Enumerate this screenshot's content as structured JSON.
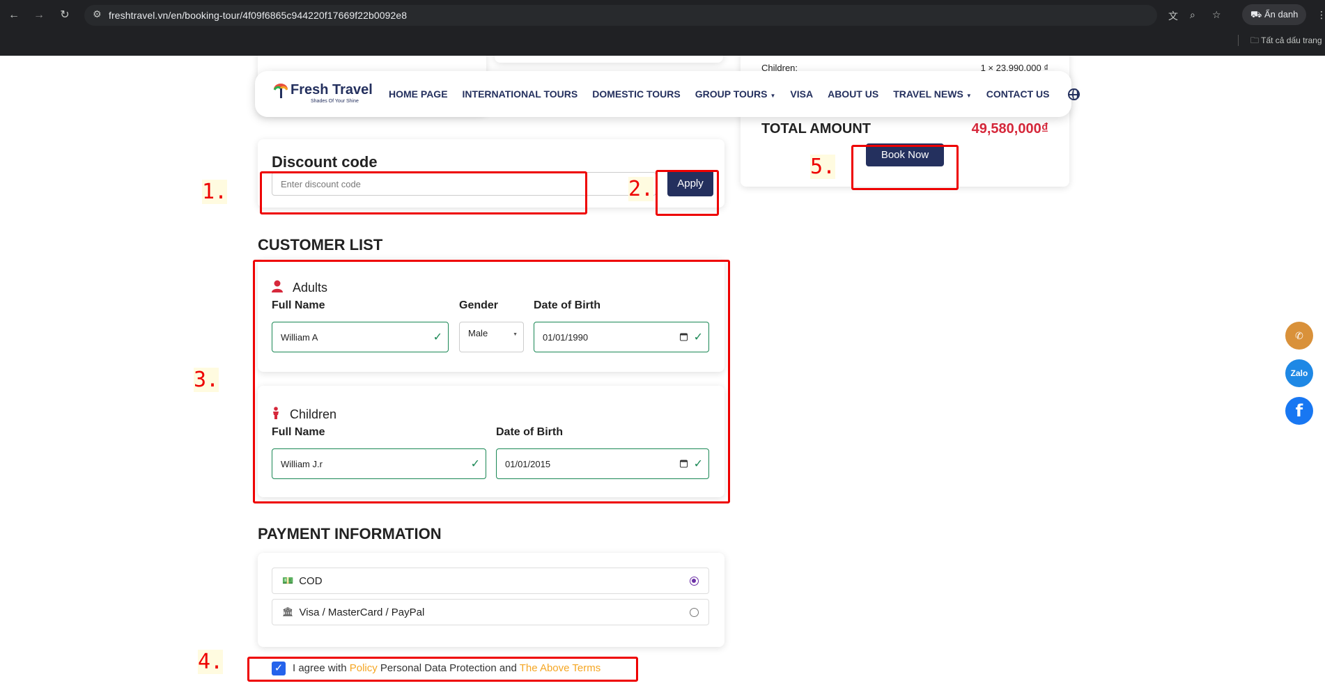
{
  "browser": {
    "url": "freshtravel.vn/en/booking-tour/4f09f6865c944220f17669f22b0092e8",
    "incognito_label": "Ẩn danh",
    "bookmarks_label": "Tất cả dấu trang"
  },
  "nav": {
    "brand": "Fresh Travel",
    "tagline": "Shades Of Your Shine",
    "items": [
      "HOME PAGE",
      "INTERNATIONAL TOURS",
      "DOMESTIC TOURS",
      "GROUP TOURS",
      "VISA",
      "ABOUT US",
      "TRAVEL NEWS",
      "CONTACT US"
    ]
  },
  "summary": {
    "children_label": "Children:",
    "children_value": "1 × 23.990.000 ₫",
    "total_label": "TOTAL AMOUNT",
    "total_value": "49,580,000₫",
    "book_now": "Book Now"
  },
  "discount": {
    "title": "Discount code",
    "placeholder": "Enter discount code",
    "apply": "Apply"
  },
  "customers": {
    "title": "CUSTOMER LIST",
    "adults": {
      "heading": "Adults",
      "full_name_label": "Full Name",
      "gender_label": "Gender",
      "dob_label": "Date of Birth",
      "full_name": "William A",
      "gender": "Male",
      "dob": "01/01/1990"
    },
    "children": {
      "heading": "Children",
      "full_name_label": "Full Name",
      "dob_label": "Date of Birth",
      "full_name": "William J.r",
      "dob": "01/01/2015"
    }
  },
  "payment": {
    "title": "PAYMENT INFORMATION",
    "options": [
      "COD",
      "Visa / MasterCard / PayPal"
    ],
    "selected": "COD"
  },
  "agree": {
    "prefix": "I agree with ",
    "policy": "Policy",
    "middle": " Personal Data Protection and ",
    "terms": "The Above Terms"
  },
  "annotations": [
    "1.",
    "2.",
    "3.",
    "4.",
    "5."
  ],
  "floating": {
    "zalo": "Zalo"
  },
  "colors": {
    "brand": "#24305e",
    "price": "#d6283b",
    "link": "#f5a623",
    "annotation": "#ee0000"
  }
}
